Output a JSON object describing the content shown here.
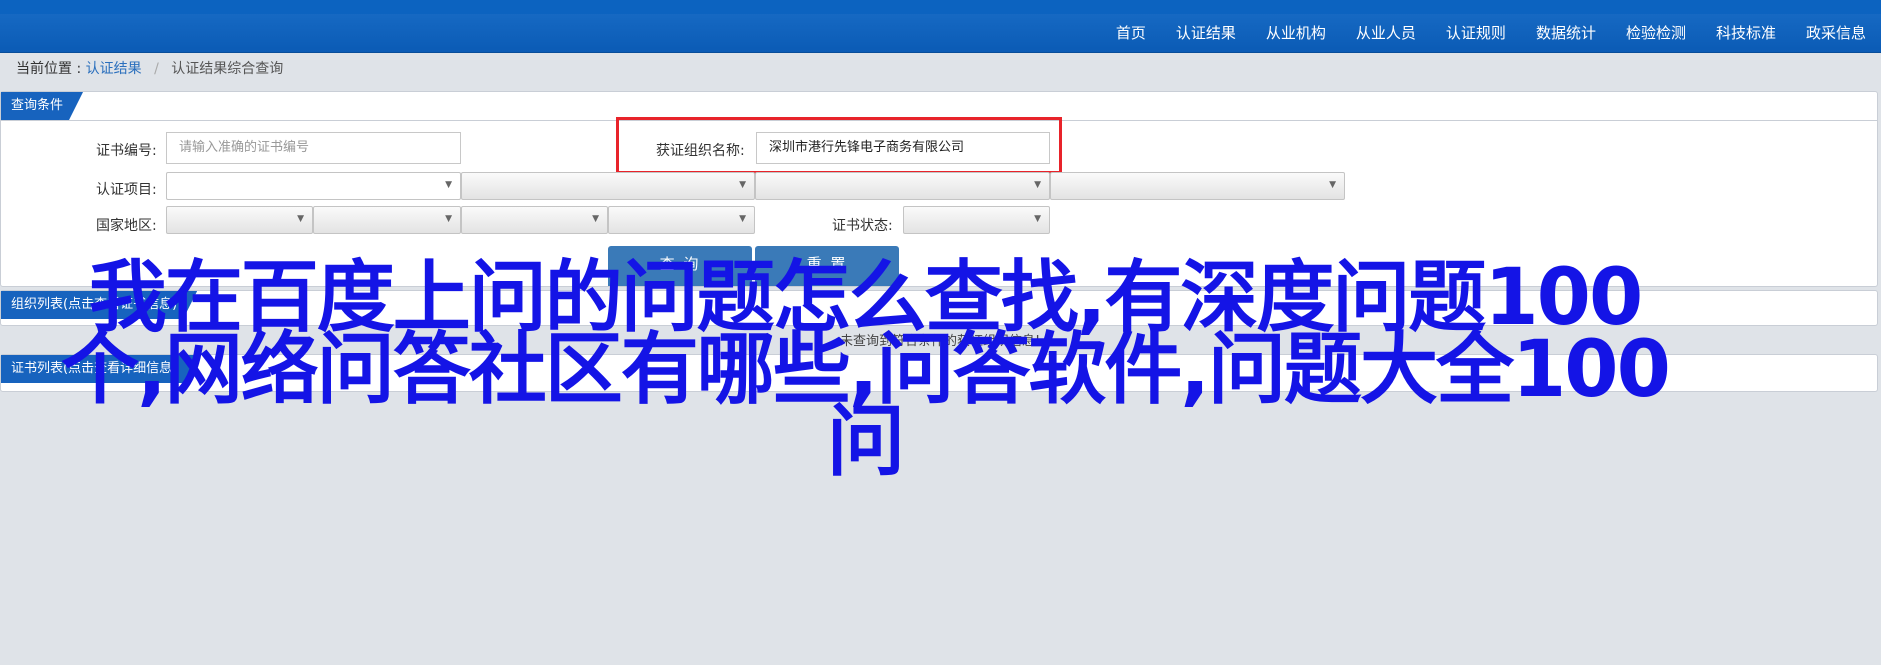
{
  "nav": {
    "items": [
      "首页",
      "认证结果",
      "从业机构",
      "从业人员",
      "认证规则",
      "数据统计",
      "检验检测",
      "科技标准",
      "政采信息"
    ]
  },
  "breadcrumb": {
    "prefix": "当前位置 :",
    "link": "认证结果",
    "separator": "/",
    "current": "认证结果综合查询"
  },
  "query_panel": {
    "title": "查询条件",
    "cert_no_label": "证书编号:",
    "cert_no_placeholder": "请输入准确的证书编号",
    "org_label": "获证组织名称:",
    "org_value": "深圳市港行先锋电子商务有限公司",
    "project_label": "认证项目:",
    "region_label": "国家地区:",
    "status_label": "证书状态:",
    "query_button": "查 询",
    "reset_button": "重 置"
  },
  "org_list_panel": {
    "title": "组织列表(点击查看证书信息)",
    "empty_message": "未查询到符合条件的获证组织信息!"
  },
  "cert_list_panel": {
    "title": "证书列表(点击查看详细信息)"
  },
  "overlay_headline": "我在百度上问的问题怎么查找,有深度问题100个,网络问答社区有哪些,问答软件,问题大全100问",
  "colors": {
    "nav_bg": "#0b5bb5",
    "tab_bg": "#1763be",
    "button_bg": "#3a7ab8",
    "highlight_border": "#e8232a",
    "headline": "#1414e6"
  }
}
